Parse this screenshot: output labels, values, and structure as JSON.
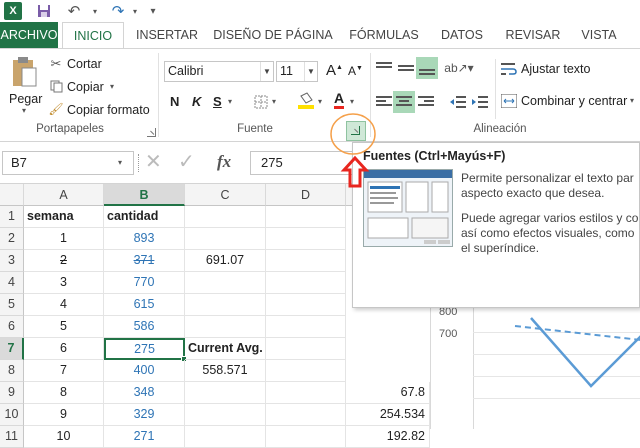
{
  "app": {
    "icon": "excel-icon"
  },
  "tabs": [
    {
      "label": "ARCHIVO"
    },
    {
      "label": "INICIO"
    },
    {
      "label": "INSERTAR"
    },
    {
      "label": "DISEÑO DE PÁGINA"
    },
    {
      "label": "FÓRMULAS"
    },
    {
      "label": "DATOS"
    },
    {
      "label": "REVISAR"
    },
    {
      "label": "VISTA"
    }
  ],
  "ribbon": {
    "clipboard": {
      "paste": "Pegar",
      "cut": "Cortar",
      "copy": "Copiar",
      "format_painter": "Copiar formato",
      "group": "Portapapeles"
    },
    "font": {
      "font_name": "Calibri",
      "font_size": "11",
      "bold": "N",
      "italic": "K",
      "underline": "S",
      "grow": "A",
      "shrink": "A",
      "font_color": "A",
      "group": "Fuente"
    },
    "alignment": {
      "wrap": "Ajustar texto",
      "merge": "Combinar y centrar",
      "group": "Alineación"
    }
  },
  "formula_bar": {
    "name_box": "B7",
    "fx": "fx",
    "value": "275"
  },
  "columns": [
    "A",
    "B",
    "C",
    "D"
  ],
  "rows": [
    {
      "num": "1",
      "a": "semana",
      "b": "cantidad",
      "c": "",
      "e": ""
    },
    {
      "num": "2",
      "a": "1",
      "b": "893",
      "c": "",
      "e": ""
    },
    {
      "num": "3",
      "a": "2",
      "b": "371",
      "c": "691.07",
      "e": ""
    },
    {
      "num": "4",
      "a": "3",
      "b": "770",
      "c": "",
      "e": ""
    },
    {
      "num": "5",
      "a": "4",
      "b": "615",
      "c": "",
      "e": ""
    },
    {
      "num": "6",
      "a": "5",
      "b": "586",
      "c": "",
      "e": ""
    },
    {
      "num": "7",
      "a": "6",
      "b": "275",
      "c": "Current Avg.",
      "e": ""
    },
    {
      "num": "8",
      "a": "7",
      "b": "400",
      "c": "558.571",
      "e": ""
    },
    {
      "num": "9",
      "a": "8",
      "b": "348",
      "c": "",
      "e": "67.8"
    },
    {
      "num": "10",
      "a": "9",
      "b": "329",
      "c": "",
      "e": "254.534"
    },
    {
      "num": "11",
      "a": "10",
      "b": "271",
      "c": "",
      "e": "192.82"
    }
  ],
  "tooltip": {
    "title": "Fuentes (Ctrl+Mayús+F)",
    "line1": "Permite personalizar el texto par",
    "line2": "aspecto exacto que desea.",
    "line3": "Puede agregar varios estilos y co",
    "line4": "así como efectos visuales, como",
    "line5": "el superíndice."
  },
  "chart": {
    "y_tick_top": "800",
    "y_tick_bottom": "700"
  },
  "colors": {
    "excel_green": "#217346",
    "value_blue": "#2e74b5",
    "annotation_red": "#e8261f",
    "annotation_orange": "#f5a04a"
  }
}
